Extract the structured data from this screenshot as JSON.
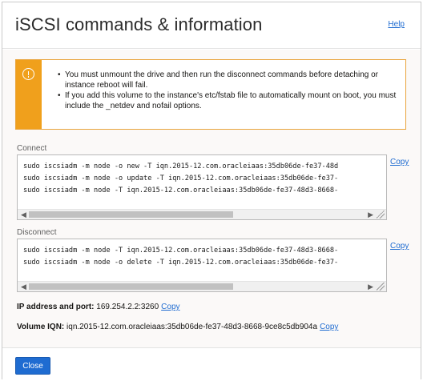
{
  "dialog": {
    "title": "iSCSI commands & information",
    "help_label": "Help"
  },
  "warning": {
    "icon": "exclamation-circle-icon",
    "messages": [
      "You must unmount the drive and then run the disconnect commands before detaching or instance reboot will fail.",
      "If you add this volume to the instance's etc/fstab file to automatically mount on boot, you must include the _netdev and nofail options."
    ]
  },
  "connect": {
    "label": "Connect",
    "lines": [
      "sudo iscsiadm -m node -o new -T iqn.2015-12.com.oracleiaas:35db06de-fe37-48d",
      "sudo iscsiadm -m node -o update -T iqn.2015-12.com.oracleiaas:35db06de-fe37-",
      "sudo iscsiadm -m node -T iqn.2015-12.com.oracleiaas:35db06de-fe37-48d3-8668-"
    ],
    "copy_label": "Copy"
  },
  "disconnect": {
    "label": "Disconnect",
    "lines": [
      "sudo iscsiadm -m node -T iqn.2015-12.com.oracleiaas:35db06de-fe37-48d3-8668-",
      "sudo iscsiadm -m node -o delete -T iqn.2015-12.com.oracleiaas:35db06de-fe37-"
    ],
    "copy_label": "Copy"
  },
  "ip": {
    "label": "IP address and port:",
    "value": "169.254.2.2:3260",
    "copy_label": "Copy"
  },
  "iqn": {
    "label": "Volume IQN:",
    "value": "iqn.2015-12.com.oracleiaas:35db06de-fe37-48d3-8668-9ce8c5db904a",
    "copy_label": "Copy"
  },
  "footer": {
    "close_label": "Close"
  },
  "colors": {
    "accent": "#1f6cd1",
    "warning": "#f0a01c"
  }
}
